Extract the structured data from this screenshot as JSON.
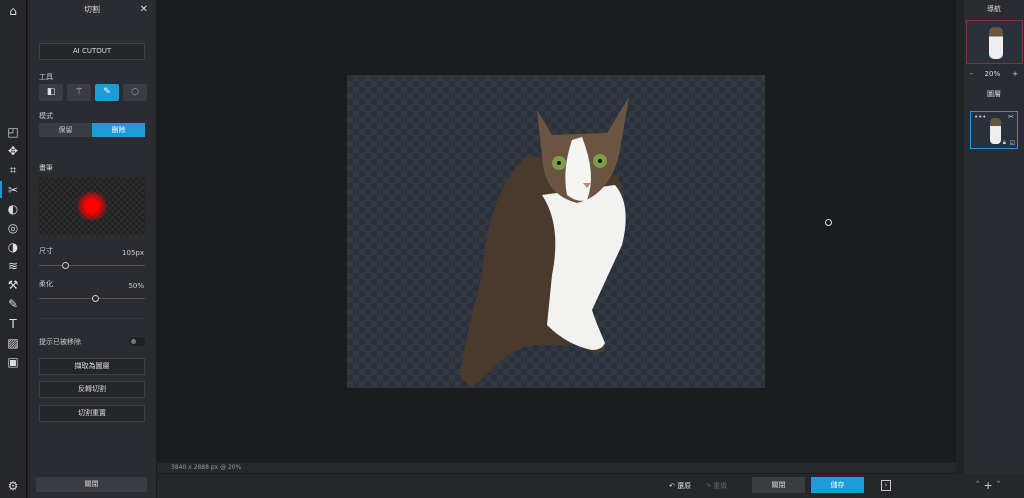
{
  "panel": {
    "title": "切割",
    "ai_cutout": "AI CUTOUT",
    "tools_label": "工具",
    "mode_label": "模式",
    "mode_keep": "保留",
    "mode_delete": "刪除",
    "brush_label": "畫筆",
    "size_label": "尺寸",
    "size_value": "105px",
    "size_fraction": 0.22,
    "soften_label": "柔化",
    "soften_value": "50%",
    "soften_fraction": 0.5,
    "hint_label": "提示已被移除",
    "hint_on": false,
    "extract_layer": "擷取為圖層",
    "invert_cut": "反轉切割",
    "reset_cut": "切割重置",
    "close": "關閉"
  },
  "status": "3840 x 2888 px @ 20%",
  "bottom": {
    "undo": "還原",
    "redo": "重做",
    "close": "關閉",
    "save": "儲存"
  },
  "right": {
    "navigator": "導航",
    "zoom": "20%",
    "zoom_minus": "-",
    "zoom_plus": "+",
    "layers": "圖層"
  },
  "colors": {
    "accent": "#1e9bd7",
    "brush": "#ff0000"
  }
}
